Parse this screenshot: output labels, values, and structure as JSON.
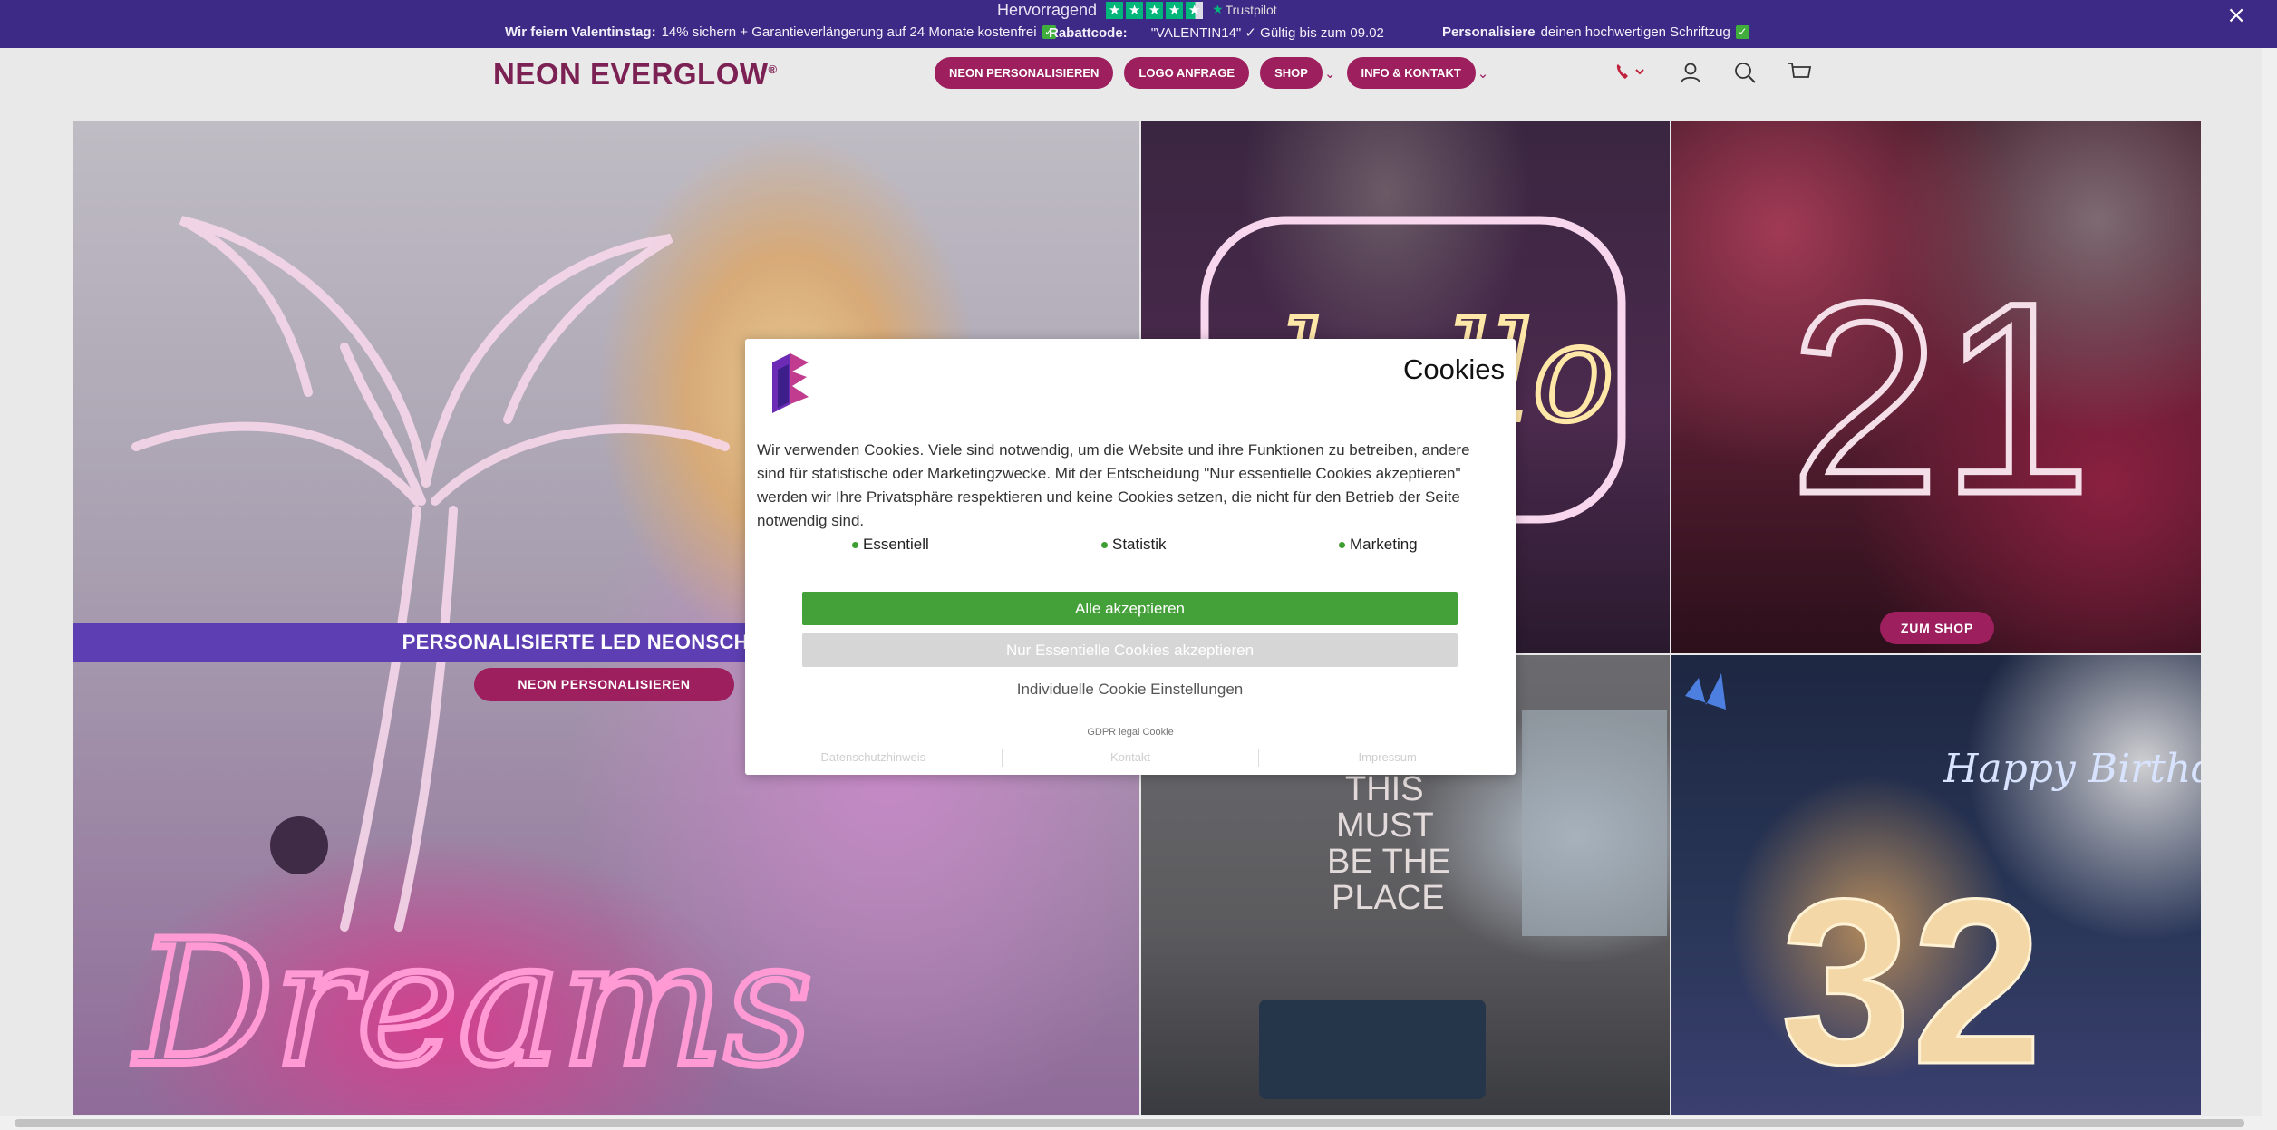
{
  "announcement": {
    "rating_text": "Hervorragend",
    "trustpilot_label": "Trustpilot",
    "promos": [
      {
        "bold": "Wir feiern Valentinstag:",
        "text": "14% sichern + Garantieverlängerung auf 24 Monate kostenfrei"
      },
      {
        "bold": "Rabattcode:",
        "text": "\"VALENTIN14\" ✓ Gültig bis zum 09.02"
      },
      {
        "bold": "Personalisiere",
        "text": "deinen hochwertigen Schriftzug"
      }
    ],
    "close_symbol": "×"
  },
  "header": {
    "logo_text": "NEON EVERGLOW",
    "logo_mark": "®",
    "nav": [
      {
        "label": "NEON PERSONALISIEREN",
        "dropdown": false
      },
      {
        "label": "LOGO ANFRAGE",
        "dropdown": false
      },
      {
        "label": "SHOP",
        "dropdown": true
      },
      {
        "label": "INFO & KONTAKT",
        "dropdown": true
      }
    ],
    "icons": [
      "phone-icon",
      "account-icon",
      "search-icon",
      "cart-icon"
    ]
  },
  "hero": {
    "banner_text": "PERSONALISIERTE LED NEONSCHILDER",
    "personalize_button": "NEON PERSONALISIEREN",
    "shop_button": "ZUM SHOP",
    "neon_words": {
      "dreams": "Dreams",
      "hello": "hello",
      "number_21": "21",
      "place_lines": [
        "THIS",
        "MUST",
        "BE THE",
        "PLACE"
      ],
      "happy_birthday": "Happy Birthday",
      "number_32": "32"
    }
  },
  "cookie_modal": {
    "title": "Cookies",
    "body": "Wir verwenden Cookies. Viele sind notwendig, um die Website und ihre Funktionen zu betreiben, andere sind für statistische oder Marketingzwecke. Mit der Entscheidung \"Nur essentielle Cookies akzeptieren\" werden wir Ihre Privatsphäre respektieren und keine Cookies setzen, die nicht für den Betrieb der Seite notwendig sind.",
    "options": [
      "Essentiell",
      "Statistik",
      "Marketing"
    ],
    "accept_all": "Alle akzeptieren",
    "accept_essential": "Nur Essentielle Cookies akzeptieren",
    "individual": "Individuelle Cookie Einstellungen",
    "gdpr": "GDPR legal Cookie",
    "footer_links": [
      "Datenschutzhinweis",
      "Kontakt",
      "Impressum"
    ]
  },
  "colors": {
    "announcement_bg": "#3d2a86",
    "brand_magenta": "#9d1f5e",
    "banner_purple": "#5d3fb3",
    "accept_green": "#44a038",
    "trustpilot_green": "#00b67a"
  }
}
